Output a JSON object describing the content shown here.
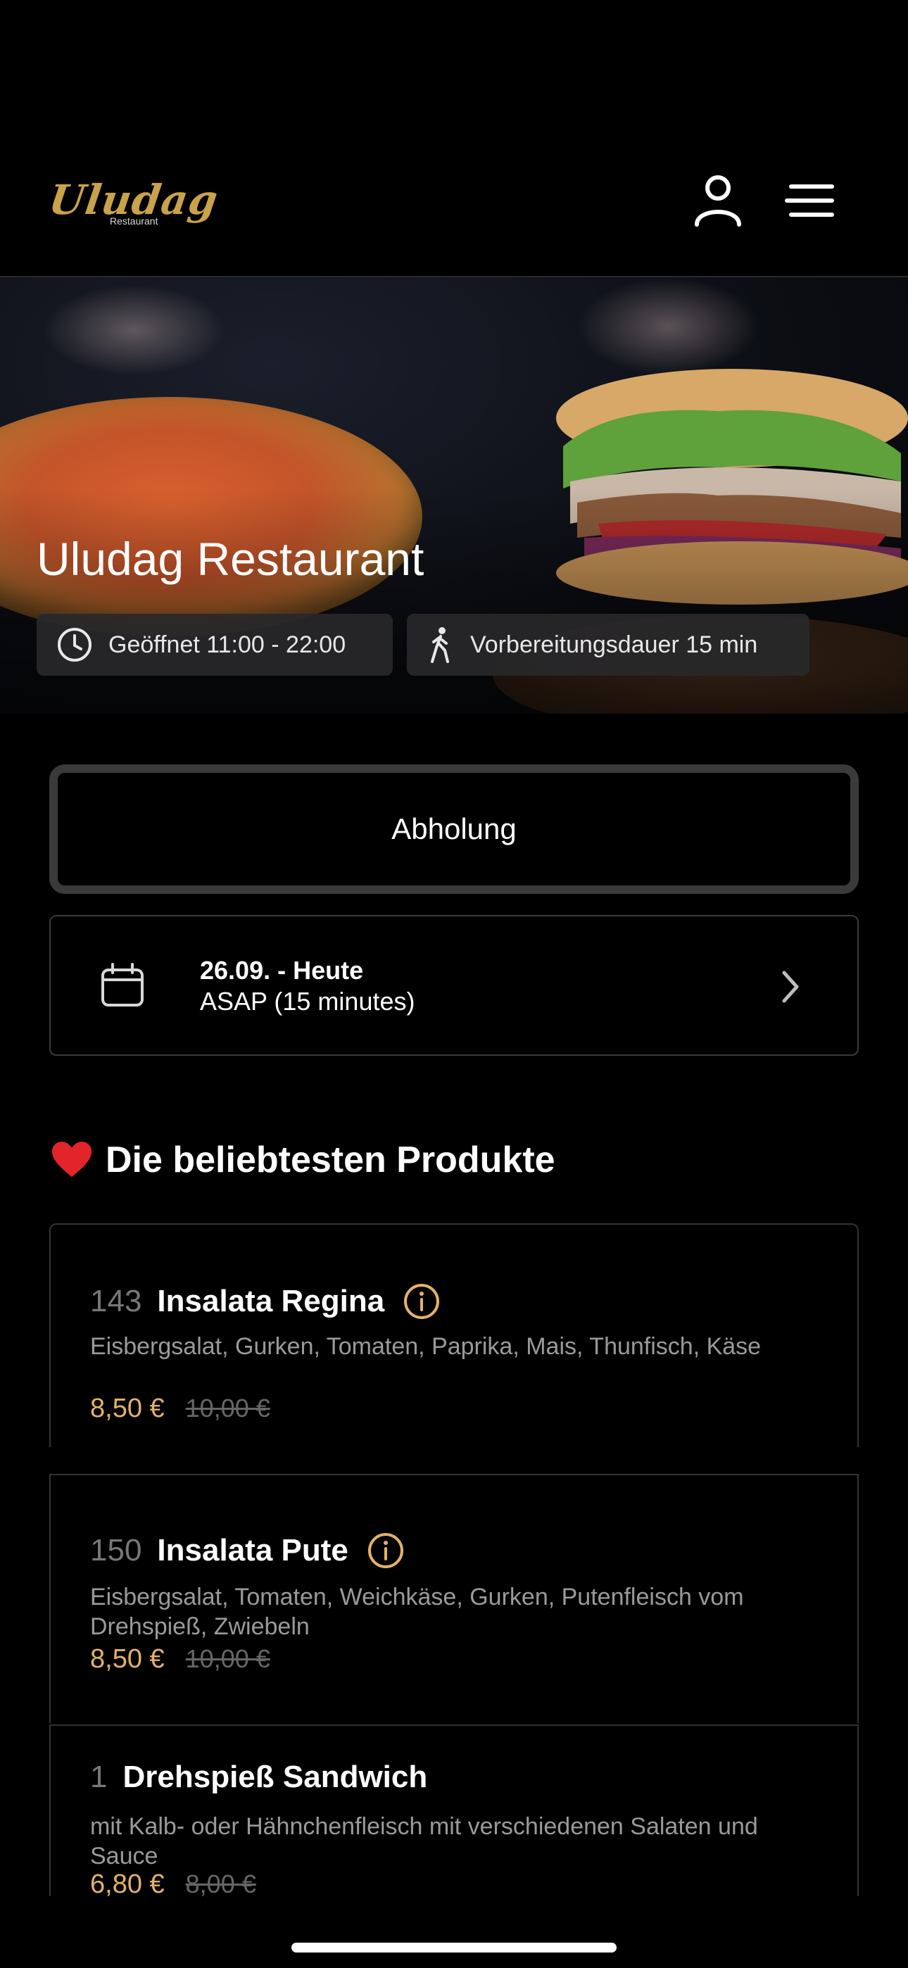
{
  "header": {
    "logo_text": "Uludag",
    "logo_subtitle": "Restaurant",
    "user_icon": "user-icon",
    "menu_icon": "hamburger-menu-icon"
  },
  "hero": {
    "title": "Uludag Restaurant",
    "opening_label": "Geöffnet 11:00 - 22:00",
    "prep_label": "Vorbereitungsdauer 15 min"
  },
  "order_mode": {
    "label": "Abholung"
  },
  "date_picker": {
    "date": "26.09. - Heute",
    "time": "ASAP (15 minutes)"
  },
  "popular": {
    "title": "Die beliebtesten Produkte",
    "products": [
      {
        "number": "143",
        "name": "Insalata Regina",
        "description": "Eisbergsalat, Gurken, Tomaten, Paprika, Mais, Thunfisch, Käse",
        "price": "8,50 €",
        "old_price": "10,00 €",
        "has_info": true
      },
      {
        "number": "150",
        "name": "Insalata Pute",
        "description": "Eisbergsalat, Tomaten, Weichkäse, Gurken, Putenfleisch vom Drehspieß, Zwiebeln",
        "price": "8,50 €",
        "old_price": "10,00 €",
        "has_info": true
      },
      {
        "number": "1",
        "name": "Drehspieß Sandwich",
        "description": "mit Kalb- oder Hähnchenfleisch mit verschiedenen Salaten und Sauce",
        "price": "6,80 €",
        "old_price": "8,00 €",
        "has_info": false
      }
    ]
  },
  "colors": {
    "background": "#000000",
    "accent_gold": "#e3b26a",
    "border": "#3a3a3a"
  }
}
